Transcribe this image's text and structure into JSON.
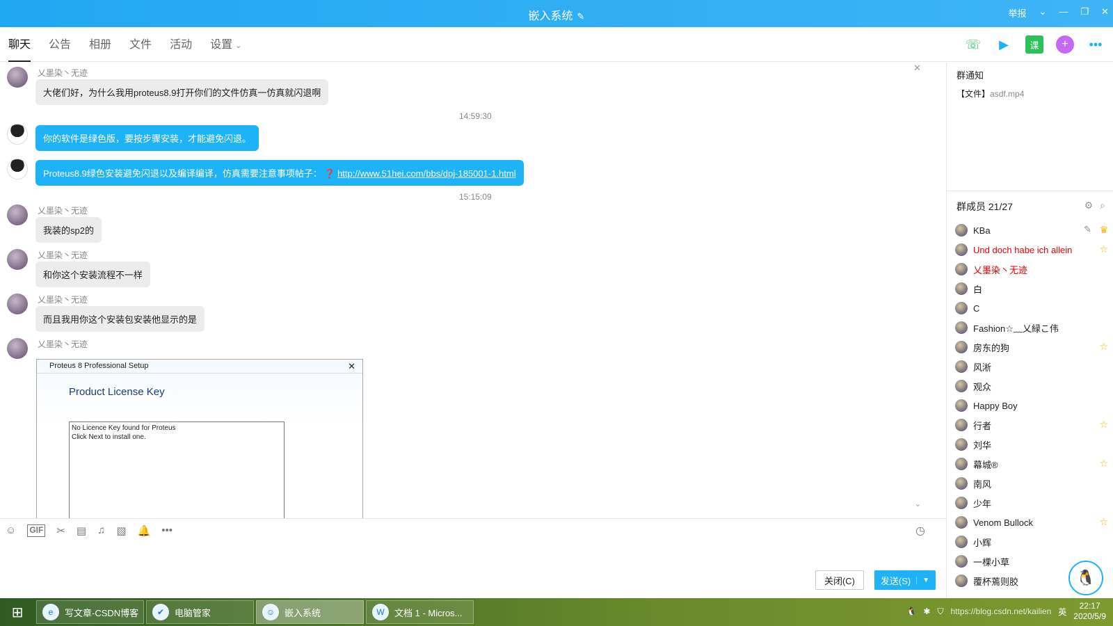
{
  "window": {
    "title": "嵌入系统",
    "report": "举报"
  },
  "tabs": [
    {
      "label": "聊天"
    },
    {
      "label": "公告"
    },
    {
      "label": "相册"
    },
    {
      "label": "文件"
    },
    {
      "label": "活动"
    },
    {
      "label": "设置"
    }
  ],
  "messages": [
    {
      "sender": "乂墨染丶无迹",
      "text": "大佬们好，为什么我用proteus8.9打开你们的文件仿真一仿真就闪退啊"
    },
    {
      "timestamp": "14:59:30"
    },
    {
      "text": "你的软件是绿色版，要按步骤安装，才能避免闪退。"
    },
    {
      "text_prefix": "Proteus8.9绿色安装避免闪退以及编译编译，仿真需要注意事项帖子：",
      "link": "http://www.51hei.com/bbs/dpj-185001-1.html"
    },
    {
      "timestamp": "15:15:09"
    },
    {
      "sender": "乂墨染丶无迹",
      "text": "我装的sp2的"
    },
    {
      "sender": "乂墨染丶无迹",
      "text": "和你这个安装流程不一样"
    },
    {
      "sender": "乂墨染丶无迹",
      "text": "而且我用你这个安装包安装他显示的是"
    },
    {
      "sender": "乂墨染丶无迹"
    }
  ],
  "screenshot": {
    "titlebar": "Proteus 8 Professional Setup",
    "heading": "Product License Key",
    "line1": "No Licence Key found for Proteus",
    "line2": "Click Next to install one."
  },
  "buttons": {
    "close": "关闭(C)",
    "send": "发送(S)"
  },
  "notice": {
    "title": "群通知",
    "file_tag": "【文件】",
    "file_name": "asdf.mp4"
  },
  "members": {
    "header": "群成员 21/27",
    "list": [
      {
        "name": "KBa",
        "owner": true
      },
      {
        "name": "Und doch habe ich allein",
        "red": true,
        "star": true
      },
      {
        "name": "乂墨染丶无迹",
        "red": true
      },
      {
        "name": "白"
      },
      {
        "name": "C"
      },
      {
        "name": "Fashion☆﹏乂緑こ伟"
      },
      {
        "name": "房东的狗",
        "star": true
      },
      {
        "name": "风淅"
      },
      {
        "name": "观众"
      },
      {
        "name": "Happy Boy"
      },
      {
        "name": "行者",
        "star": true
      },
      {
        "name": "刘华"
      },
      {
        "name": "幕城®",
        "star": true
      },
      {
        "name": "南风"
      },
      {
        "name": "少年"
      },
      {
        "name": "Venom Bullock",
        "star": true
      },
      {
        "name": "小辉"
      },
      {
        "name": "一棵小草"
      },
      {
        "name": "覆杯蔫则胶"
      }
    ]
  },
  "taskbar": {
    "tasks": [
      {
        "label": "写文章-CSDN博客"
      },
      {
        "label": "电脑管家"
      },
      {
        "label": "嵌入系统"
      },
      {
        "label": "文档 1 - Micros..."
      }
    ],
    "time": "22:17",
    "date": "2020/5/9",
    "ime": "英",
    "watermark": "https://blog.csdn.net/kailien"
  }
}
